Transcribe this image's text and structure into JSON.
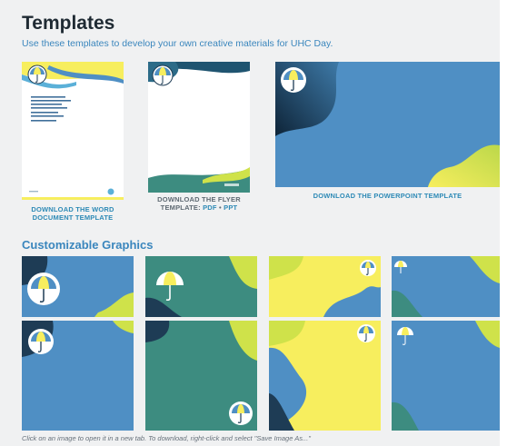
{
  "header": {
    "title": "Templates",
    "subtitle": "Use these templates to develop your own creative materials for UHC Day."
  },
  "templates": {
    "word_caption": "DOWNLOAD THE WORD DOCUMENT TEMPLATE",
    "flyer_caption": "DOWNLOAD THE FLYER TEMPLATE:",
    "flyer_pdf": "PDF",
    "flyer_sep": "•",
    "flyer_ppt": "PPT",
    "ppt_caption": "DOWNLOAD THE POWERPOINT TEMPLATE"
  },
  "graphics": {
    "title": "Customizable Graphics",
    "footnote": "Click on an image to open it in a new tab. To download, right-click and select \"Save Image As...\""
  },
  "colors": {
    "blue": "#4f8fc4",
    "navy": "#1e3c55",
    "teal": "#3d8c80",
    "yellow": "#f7ee5e",
    "lime": "#cfe24a",
    "link": "#2e8ab6"
  }
}
